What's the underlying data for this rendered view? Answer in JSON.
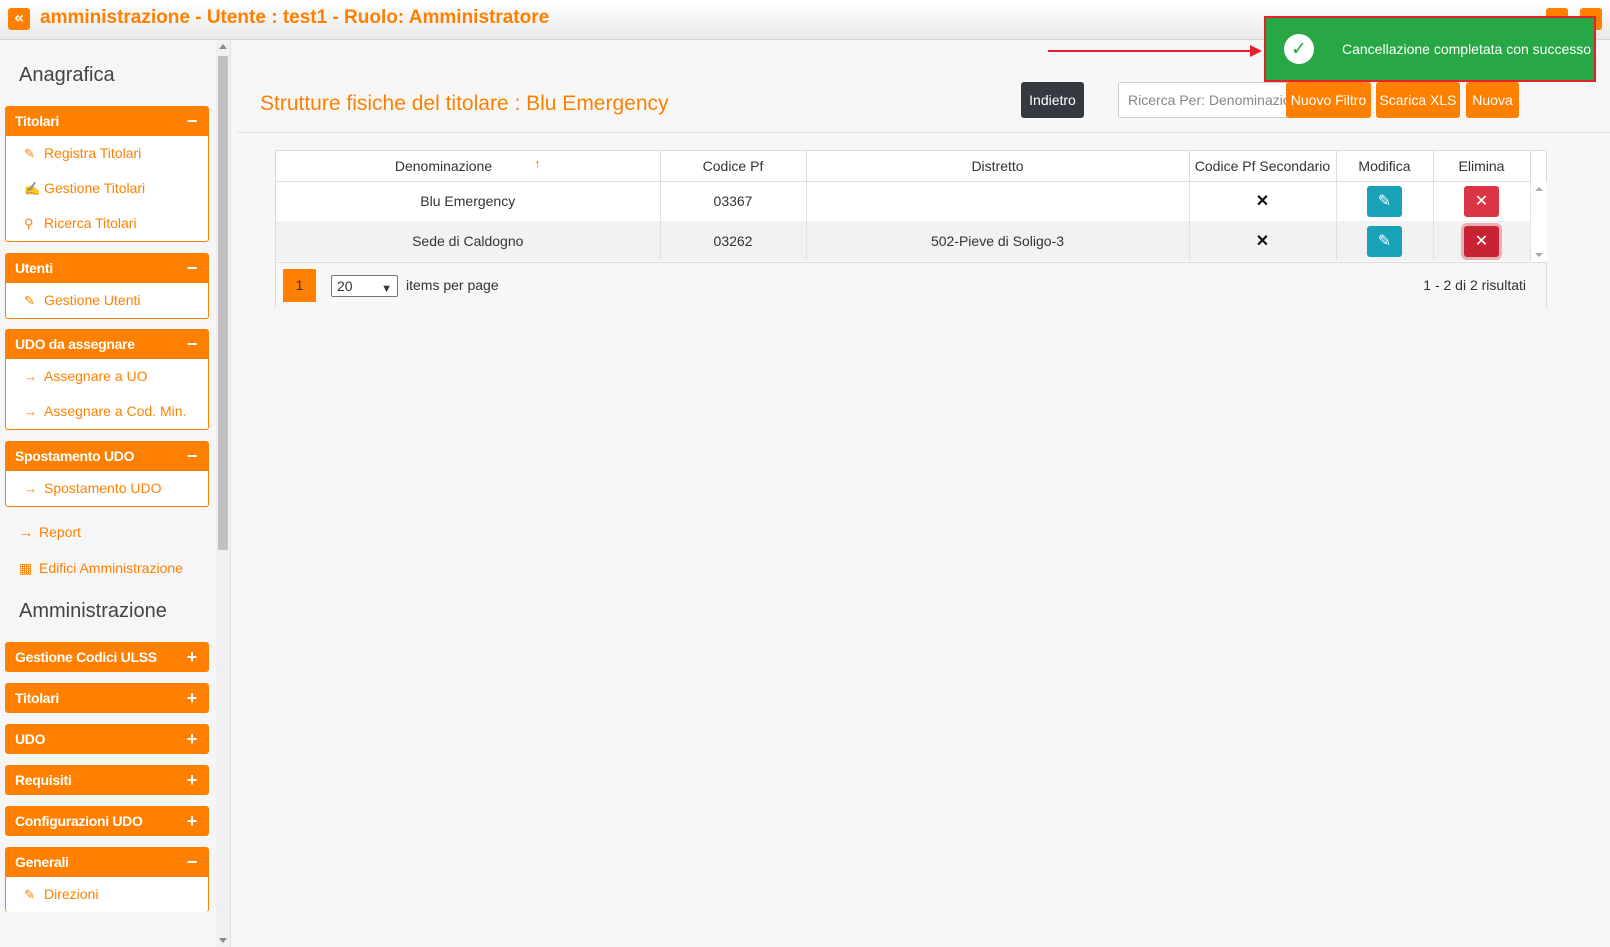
{
  "header": {
    "collapse_glyph": "«",
    "title": "amministrazione - Utente : test1 - Ruolo: Amministratore"
  },
  "sidebar": {
    "anagrafica_title": "Anagrafica",
    "groups": [
      {
        "label": "Titolari",
        "toggle": "−",
        "items": [
          {
            "label": "Registra Titolari",
            "icon": "user-edit-icon"
          },
          {
            "label": "Gestione Titolari",
            "icon": "edit-icon"
          },
          {
            "label": "Ricerca Titolari",
            "icon": "search-icon"
          }
        ]
      },
      {
        "label": "Utenti",
        "toggle": "−",
        "items": [
          {
            "label": "Gestione Utenti",
            "icon": "user-edit-icon"
          }
        ]
      },
      {
        "label": "UDO da assegnare",
        "toggle": "−",
        "items": [
          {
            "label": "Assegnare a UO",
            "icon": "arrow-right-icon"
          },
          {
            "label": "Assegnare a Cod. Min.",
            "icon": "arrow-right-icon"
          }
        ]
      },
      {
        "label": "Spostamento UDO",
        "toggle": "−",
        "items": [
          {
            "label": "Spostamento UDO",
            "icon": "arrow-right-icon"
          }
        ]
      }
    ],
    "report_label": "Report",
    "edifici_label": "Edifici Amministrazione",
    "amministrazione_title": "Amministrazione",
    "admin_groups": [
      {
        "label": "Gestione Codici ULSS",
        "toggle": "+"
      },
      {
        "label": "Titolari",
        "toggle": "+"
      },
      {
        "label": "UDO",
        "toggle": "+"
      },
      {
        "label": "Requisiti",
        "toggle": "+"
      },
      {
        "label": "Configurazioni UDO",
        "toggle": "+"
      },
      {
        "label": "Generali",
        "toggle": "−",
        "items": [
          {
            "label": "Direzioni",
            "icon": "user-edit-icon"
          }
        ]
      }
    ]
  },
  "main": {
    "page_title": "Strutture fisiche del titolare : Blu Emergency",
    "buttons": {
      "back": "Indietro",
      "search_placeholder": "Ricerca Per: Denominazione",
      "new_filter": "Nuovo Filtro",
      "download_xls": "Scarica XLS",
      "new": "Nuova"
    },
    "grid": {
      "columns": [
        "Denominazione",
        "Codice Pf",
        "Distretto",
        "Codice Pf Secondario",
        "Modifica",
        "Elimina"
      ],
      "sort_indicator": "↑",
      "rows": [
        {
          "denominazione": "Blu Emergency",
          "codice_pf": "03367",
          "distretto": "",
          "secondario": "✕"
        },
        {
          "denominazione": "Sede di Caldogno",
          "codice_pf": "03262",
          "distretto": "502-Pieve di Soligo-3",
          "secondario": "✕"
        }
      ],
      "pager": {
        "current_page": "1",
        "page_size": "20",
        "items_per_page_label": "items per page",
        "range_label": "1 - 2 di 2 risultati"
      }
    }
  },
  "toast": {
    "message": "Cancellazione completata con successo",
    "color": "#28a745"
  },
  "colors": {
    "accent": "#ff8000",
    "edit": "#17a2b8",
    "delete": "#dc3545",
    "dark_button": "#343a40"
  }
}
